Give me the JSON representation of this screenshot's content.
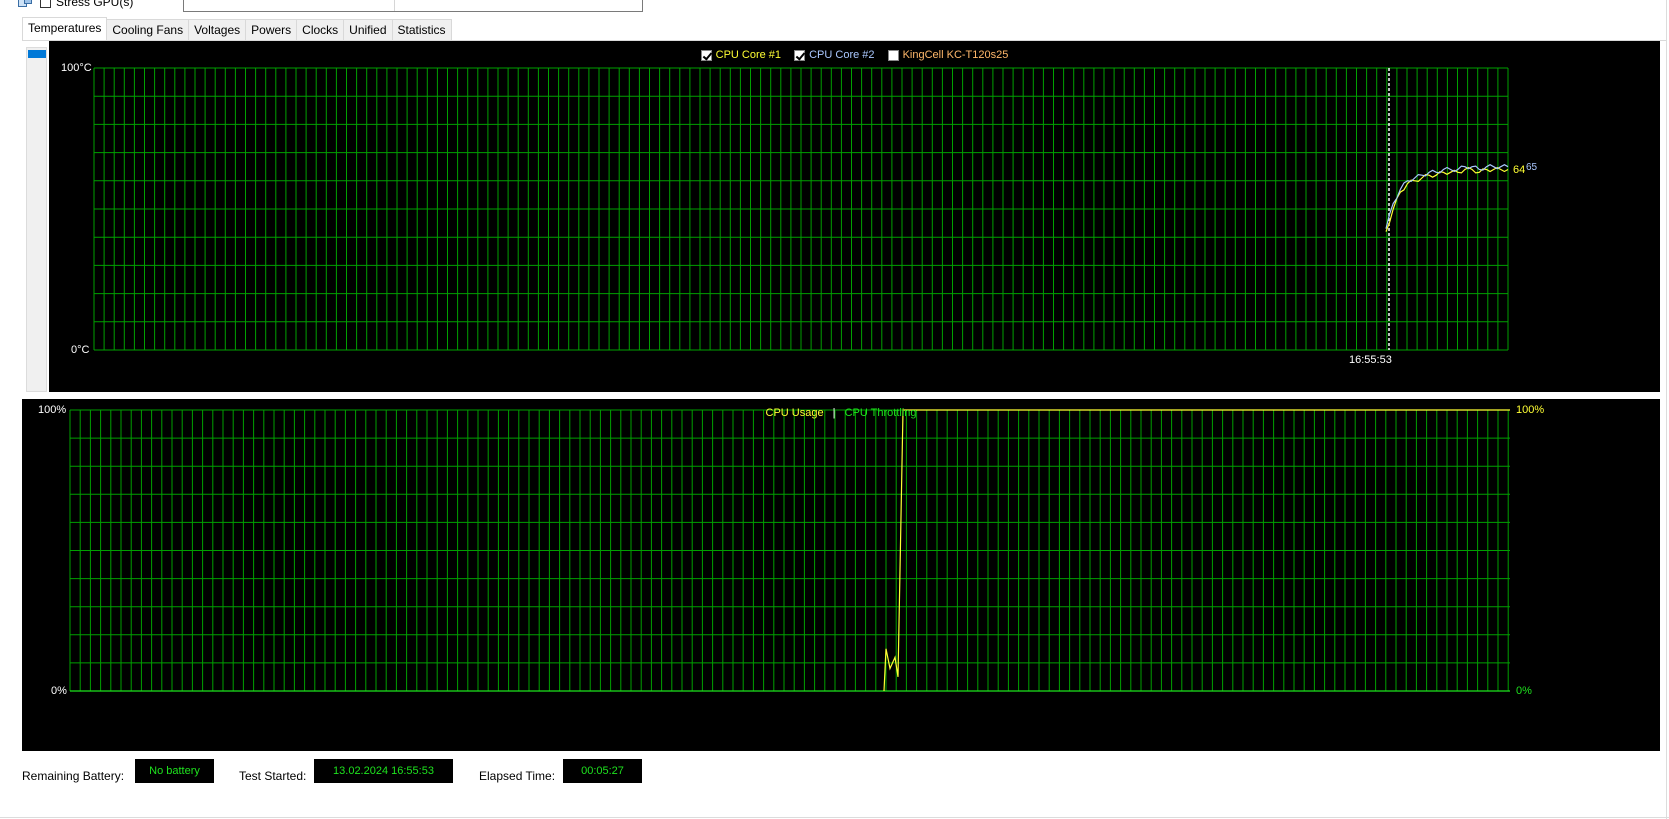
{
  "top": {
    "stress_label": "Stress GPU(s)"
  },
  "tabs": [
    "Temperatures",
    "Cooling Fans",
    "Voltages",
    "Powers",
    "Clocks",
    "Unified",
    "Statistics"
  ],
  "colors": {
    "grid": "#00a000",
    "core1": "#ffff33",
    "core2": "#aac8ff",
    "kingcell": "#ffb86b",
    "usage": "#ffff33",
    "throttling": "#1ee31e",
    "marker": "#ffffff",
    "status_text": "#1ee31e"
  },
  "temp_chart": {
    "legend": [
      {
        "label": "CPU Core #1",
        "checked": true,
        "color": "#ffff33"
      },
      {
        "label": "CPU Core #2",
        "checked": true,
        "color": "#aac8ff"
      },
      {
        "label": "KingCell KC-T120s25",
        "checked": false,
        "color": "#ffb86b"
      }
    ],
    "y_top_label": "100°C",
    "y_bottom_label": "0°C",
    "time_label": "16:55:53",
    "core1_value_label": "64",
    "core2_value_label": "65"
  },
  "usage_chart": {
    "legend_usage": "CPU Usage",
    "legend_separator": "|",
    "legend_throttling": "CPU Throttling",
    "left_top": "100%",
    "left_bottom": "0%",
    "right_top": "100%",
    "right_bottom": "0%"
  },
  "status": {
    "battery_label": "Remaining Battery:",
    "battery_value": "No battery",
    "started_label": "Test Started:",
    "started_value": "13.02.2024 16:55:53",
    "elapsed_label": "Elapsed Time:",
    "elapsed_value": "00:05:27"
  },
  "chart_data": [
    {
      "type": "line",
      "ylim": [
        0,
        100
      ],
      "series": [
        {
          "name": "CPU Core #1",
          "values": [
            42,
            50,
            56,
            59,
            60,
            61,
            62,
            62,
            63,
            63,
            63,
            64,
            64,
            63,
            64,
            64,
            64,
            64
          ]
        },
        {
          "name": "CPU Core #2",
          "values": [
            43,
            52,
            57,
            60,
            61,
            62,
            63,
            63,
            64,
            64,
            64,
            65,
            65,
            64,
            65,
            65,
            65,
            65
          ]
        }
      ]
    },
    {
      "type": "line",
      "ylim": [
        0,
        100
      ],
      "series": [
        {
          "name": "CPU Usage",
          "values": [
            0,
            15,
            8,
            12,
            5,
            100,
            100,
            100,
            100,
            100
          ]
        },
        {
          "name": "CPU Throttling",
          "values": [
            0,
            0,
            0,
            0,
            0,
            0,
            0,
            0,
            0,
            0
          ]
        }
      ]
    }
  ]
}
